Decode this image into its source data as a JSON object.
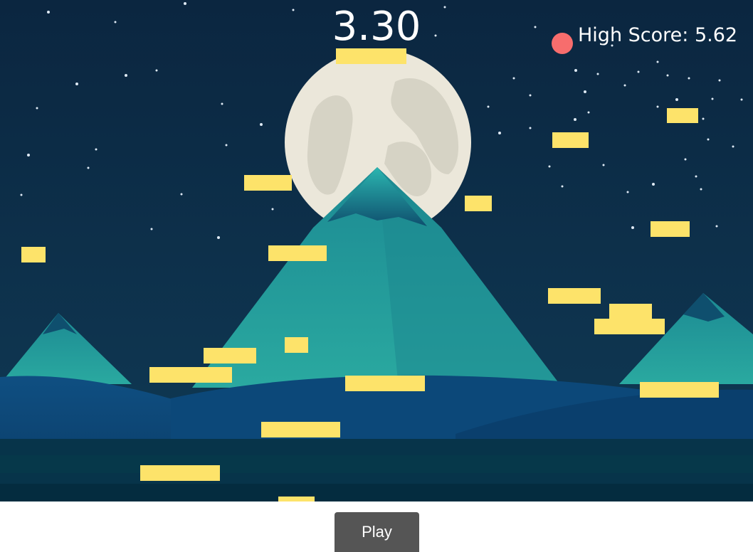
{
  "game": {
    "score": "3.30",
    "high_score_label": "High Score: 5.62",
    "ball_color": "#f76d6d",
    "platform_color": "#fde36a",
    "platform_count": 25
  },
  "controls": {
    "play_label": "Play",
    "play_color": "#555555"
  },
  "colors": {
    "sky": "#0c2a45",
    "moon": "#ebe7da",
    "mountain": "#27a19a",
    "hills": "#0e4a7a",
    "ground": "#063041"
  }
}
